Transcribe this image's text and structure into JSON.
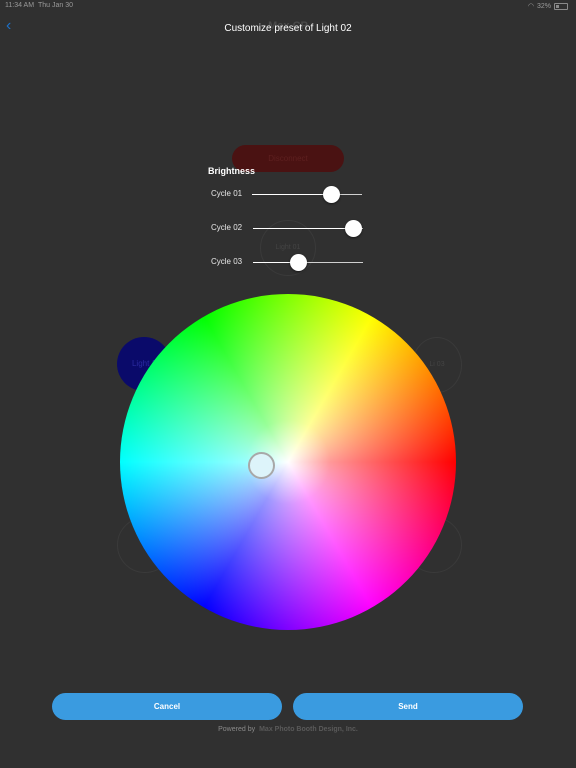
{
  "status_bar": {
    "time": "11:34 AM",
    "date": "Thu Jan 30",
    "battery": "32%"
  },
  "nav": {
    "background_title": "Max CP",
    "modal_title": "Customize preset of Light 02"
  },
  "background": {
    "disconnect_label": "Disconnect",
    "light1_label": "Light 1",
    "center_label": "Light 01",
    "side_label": "Li 03"
  },
  "brightness": {
    "heading": "Brightness",
    "sliders": [
      {
        "label": "Cycle 01",
        "value": 0.72
      },
      {
        "label": "Cycle 02",
        "value": 0.91
      },
      {
        "label": "Cycle 03",
        "value": 0.41
      }
    ]
  },
  "color_picker": {
    "selected_color": "#ddf4fa"
  },
  "actions": {
    "cancel_label": "Cancel",
    "send_label": "Send"
  },
  "footer": {
    "powered_by": "Powered by",
    "company": "Max Photo Booth Design, Inc."
  },
  "colors": {
    "accent": "#3a9be0",
    "back_arrow": "#1c70c8"
  }
}
